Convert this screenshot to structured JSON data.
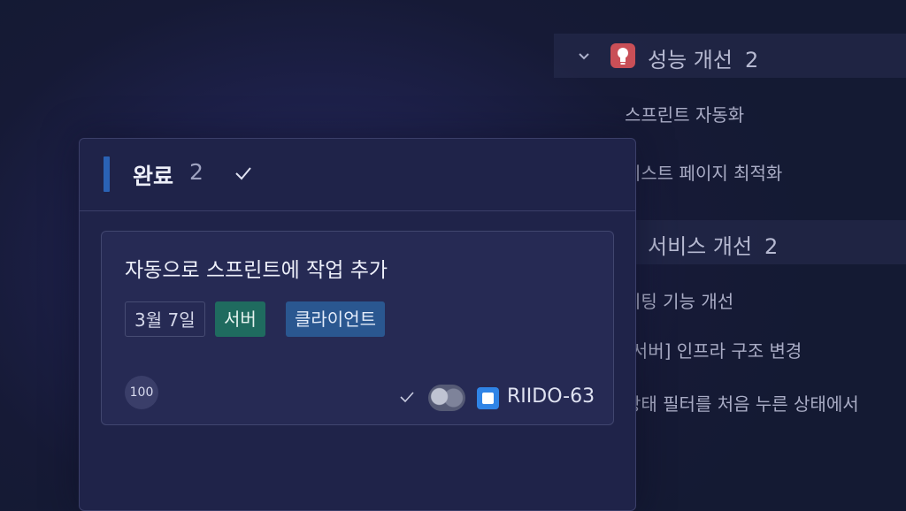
{
  "right_list": {
    "group1": {
      "title": "성능 개선",
      "count": "2"
    },
    "group1_items": [
      "스프린트 자동화",
      "리스트 페이지 최적화"
    ],
    "group2": {
      "title": "서비스 개선",
      "count": "2"
    },
    "group2_items": [
      "미팅 기능 개선",
      "[서버] 인프라 구조 변경",
      "상태 필터를 처음 누른 상태에서"
    ],
    "idea_icon": "lightbulb-icon",
    "chevron_icon": "chevron-down-icon"
  },
  "column": {
    "title": "완료",
    "count": "2",
    "check_icon": "checkmark-icon",
    "accent_color": "#2a62b5"
  },
  "card": {
    "title": "자동으로 스프린트에 작업 추가",
    "date": "3월 7일",
    "labels": [
      {
        "text": "서버",
        "color": "#1f6b5f"
      },
      {
        "text": "클라이언트",
        "color": "#2a5790"
      }
    ],
    "estimate": "100",
    "issue_key": "RIIDO-63",
    "type_icon_color": "#2f84e6"
  }
}
